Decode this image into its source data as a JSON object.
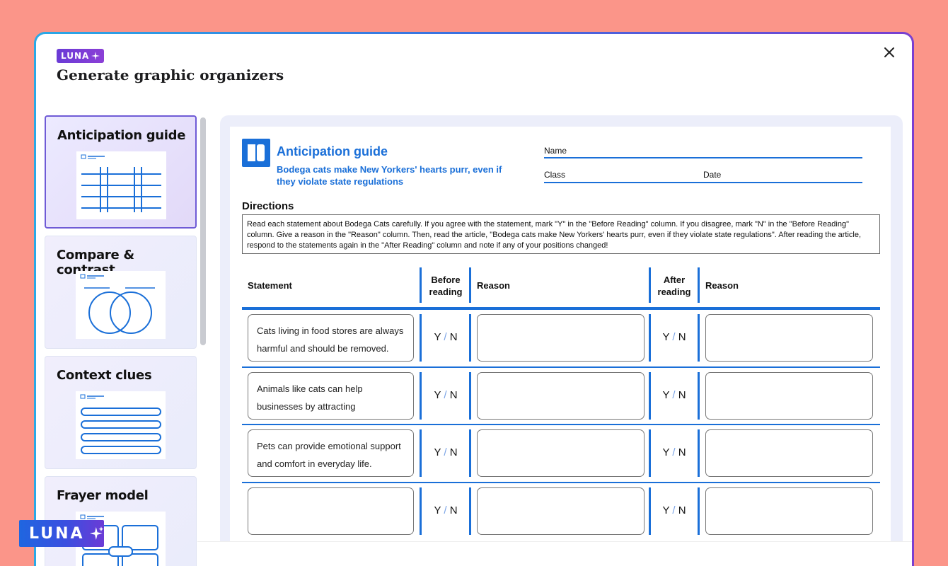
{
  "header": {
    "badge": "LUNA",
    "title": "Generate graphic organizers",
    "close_icon": "close-icon"
  },
  "sidebar": {
    "items": [
      {
        "label": "Anticipation guide",
        "selected": true,
        "thumb": "table-thumbnail"
      },
      {
        "label": "Compare & contrast",
        "selected": false,
        "thumb": "venn-diagram-thumbnail"
      },
      {
        "label": "Context clues",
        "selected": false,
        "thumb": "list-thumbnail"
      },
      {
        "label": "Frayer model",
        "selected": false,
        "thumb": "frayer-thumbnail"
      }
    ]
  },
  "document": {
    "title": "Anticipation guide",
    "subtitle": "Bodega cats make New Yorkers' hearts purr, even if they violate state regulations",
    "fields": {
      "name": "Name",
      "class": "Class",
      "date": "Date"
    },
    "directions_title": "Directions",
    "directions_text": "Read each statement about Bodega Cats carefully. If you agree with the statement, mark \"Y\" in the \"Before Reading\" column. If you disagree, mark \"N\" in the \"Before Reading\" column. Give a reason in the \"Reason\" column. Then, read the article, \"Bodega cats make New Yorkers' hearts purr, even if they violate state regulations\". After reading the article, respond to the statements again in the \"After Reading\" column and note if any of your positions changed!",
    "columns": {
      "statement": "Statement",
      "before": "Before reading",
      "reason1": "Reason",
      "after": "After reading",
      "reason2": "Reason"
    },
    "rows": [
      {
        "statement": "Cats living in food stores are always harmful and should be removed."
      },
      {
        "statement": "Animals like cats can help businesses by attracting"
      },
      {
        "statement": "Pets can provide emotional support and comfort in everyday life."
      },
      {
        "statement": ""
      }
    ],
    "yn": {
      "y": "Y",
      "slash": "/",
      "n": "N"
    }
  },
  "floating_badge": "LUNA",
  "colors": {
    "background": "#fb9589",
    "accent_blue": "#1a6fd8",
    "luna_purple": "#6a3bd6"
  }
}
